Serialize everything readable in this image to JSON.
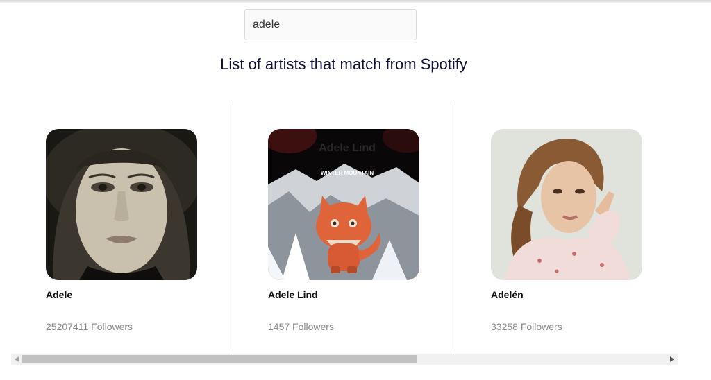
{
  "search": {
    "value": "adele"
  },
  "heading": "List of artists that match from Spotify",
  "artists": [
    {
      "name": "Adele",
      "followers": "25207411 Followers",
      "image_icon": "portrait-image"
    },
    {
      "name": "Adele Lind",
      "followers": "1457 Followers",
      "image_icon": "album-art-fox-image",
      "cover_title": "Adele Lind",
      "cover_subtitle": "WINTER MOUNTAIN"
    },
    {
      "name": "Adelén",
      "followers": "33258 Followers",
      "image_icon": "portrait-image"
    }
  ],
  "scrollbar": {
    "thumb_fraction": 0.6,
    "left_icon": "triangle-left-icon",
    "right_icon": "triangle-right-icon"
  },
  "colors": {
    "heading": "#101038",
    "divider": "#cccccc",
    "followers": "#888888",
    "fox": "#e0643a"
  }
}
